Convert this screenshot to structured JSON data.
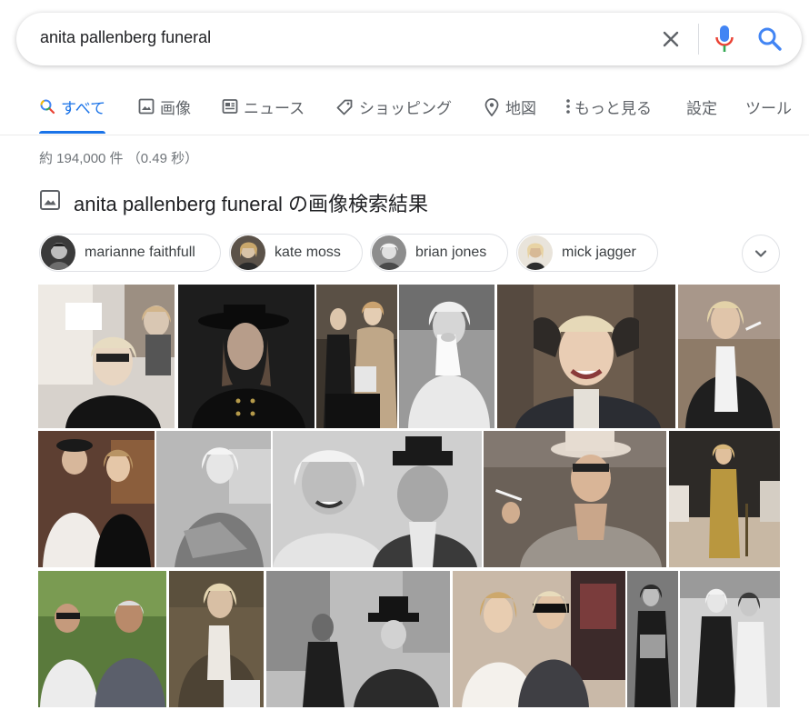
{
  "search": {
    "query": "anita pallenberg funeral"
  },
  "tabs": [
    {
      "label": "すべて",
      "icon": "search-icon",
      "active": true
    },
    {
      "label": "画像",
      "icon": "image-icon"
    },
    {
      "label": "ニュース",
      "icon": "news-icon"
    },
    {
      "label": "ショッピング",
      "icon": "tag-icon"
    },
    {
      "label": "地図",
      "icon": "map-pin-icon"
    },
    {
      "label": "もっと見る",
      "icon": "more-vert-icon"
    },
    {
      "label": "設定"
    },
    {
      "label": "ツール"
    }
  ],
  "result_stats": "約 194,000 件 （0.49 秒）",
  "image_section": {
    "title": "anita pallenberg funeral の画像検索結果",
    "icon": "image-icon"
  },
  "chips": [
    {
      "label": "marianne faithfull"
    },
    {
      "label": "kate moss"
    },
    {
      "label": "brian jones"
    },
    {
      "label": "mick jagger"
    }
  ],
  "expand_icon": "chevron-down-icon",
  "colors": {
    "accent": "#1a73e8",
    "mic_blue": "#4285f4",
    "mic_red": "#ea4335",
    "mic_yellow": "#fbbc04",
    "mic_green": "#34a853",
    "text_gray": "#5f6368"
  }
}
